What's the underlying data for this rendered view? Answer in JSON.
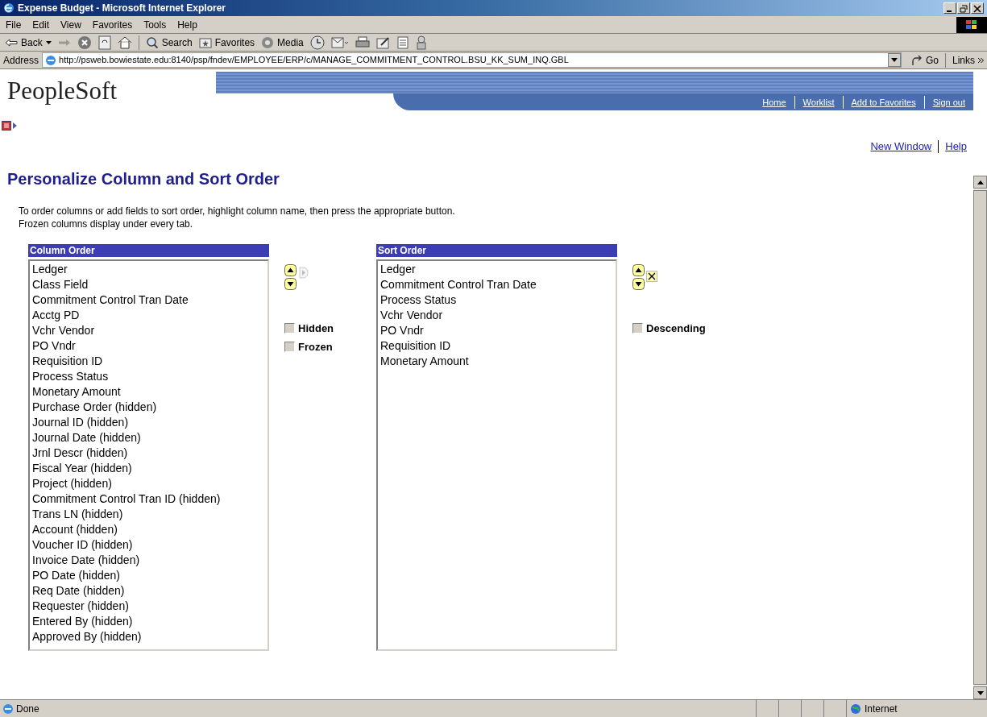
{
  "window": {
    "title": "Expense Budget - Microsoft Internet Explorer"
  },
  "menu": [
    "File",
    "Edit",
    "View",
    "Favorites",
    "Tools",
    "Help"
  ],
  "toolbar": {
    "back": "Back",
    "search": "Search",
    "favorites": "Favorites",
    "media": "Media"
  },
  "address": {
    "label": "Address",
    "url": "http://psweb.bowiestate.edu:8140/psp/fndev/EMPLOYEE/ERP/c/MANAGE_COMMITMENT_CONTROL.BSU_KK_SUM_INQ.GBL",
    "go": "Go",
    "links": "Links"
  },
  "banner": {
    "logo": "PeopleSoft",
    "nav": [
      "Home",
      "Worklist",
      "Add to Favorites",
      "Sign out"
    ]
  },
  "page_links": [
    "New Window",
    "Help"
  ],
  "heading": "Personalize Column and Sort Order",
  "instructions": [
    "To order columns or add fields to sort order, highlight column name, then press the appropriate button.",
    "Frozen columns display under every tab."
  ],
  "column_order": {
    "title": "Column Order",
    "items": [
      "Ledger",
      "Class Field",
      "Commitment Control Tran Date",
      "Acctg PD",
      "Vchr Vendor",
      "PO Vndr",
      "Requisition ID",
      "Process Status",
      "Monetary Amount",
      "Purchase Order (hidden)",
      "Journal ID (hidden)",
      "Journal Date (hidden)",
      "Jrnl Descr (hidden)",
      "Fiscal Year (hidden)",
      "Project (hidden)",
      "Commitment Control Tran ID (hidden)",
      "Trans LN (hidden)",
      "Account (hidden)",
      "Voucher ID (hidden)",
      "Invoice Date (hidden)",
      "PO Date (hidden)",
      "Req Date (hidden)",
      "Requester (hidden)",
      "Entered By (hidden)",
      "Approved By (hidden)"
    ],
    "checkboxes": [
      {
        "label": "Hidden",
        "checked": false
      },
      {
        "label": "Frozen",
        "checked": false
      }
    ]
  },
  "sort_order": {
    "title": "Sort Order",
    "items": [
      "Ledger",
      "Commitment Control Tran Date",
      "Process Status",
      "Vchr Vendor",
      "PO Vndr",
      "Requisition ID",
      "Monetary Amount"
    ],
    "checkboxes": [
      {
        "label": "Descending",
        "checked": false
      }
    ]
  },
  "status_bar": {
    "text": "Done",
    "zone": "Internet"
  }
}
